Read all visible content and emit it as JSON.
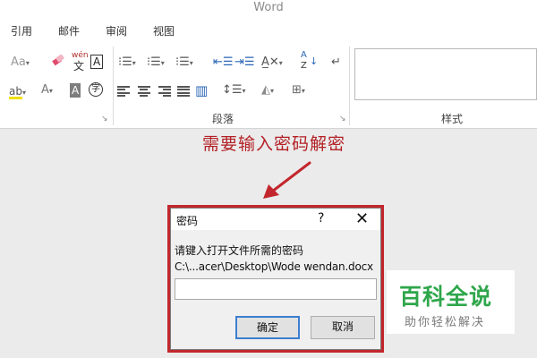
{
  "window": {
    "app_title": "Word"
  },
  "tabs": [
    {
      "label": "引用"
    },
    {
      "label": "邮件"
    },
    {
      "label": "审阅"
    },
    {
      "label": "视图"
    }
  ],
  "ribbon": {
    "groups": {
      "paragraph": "段落",
      "styles": "样式"
    },
    "icons": {
      "font_case": "Aa",
      "wen_top": "wén",
      "wen_bottom": "文",
      "char_border": "A",
      "shading_a": "A",
      "enclosed_char": "字",
      "font_color": "A",
      "highlight": "ab",
      "sort_top": "A",
      "sort_bottom": "Z"
    },
    "accent_color": "#2b67b8"
  },
  "annotation": {
    "text": "需要输入密码解密",
    "color": "#b32025"
  },
  "dialog": {
    "title": "密码",
    "help": "?",
    "close": "✕",
    "prompt": "请键入打开文件所需的密码",
    "path": "C:\\...acer\\Desktop\\Wode wendan.docx",
    "password_value": "",
    "ok_label": "确定",
    "cancel_label": "取消",
    "highlight_color": "#c2272d"
  },
  "watermark": {
    "main": "百科全说",
    "sub": "助你轻松解决",
    "color": "#2fa64b"
  }
}
